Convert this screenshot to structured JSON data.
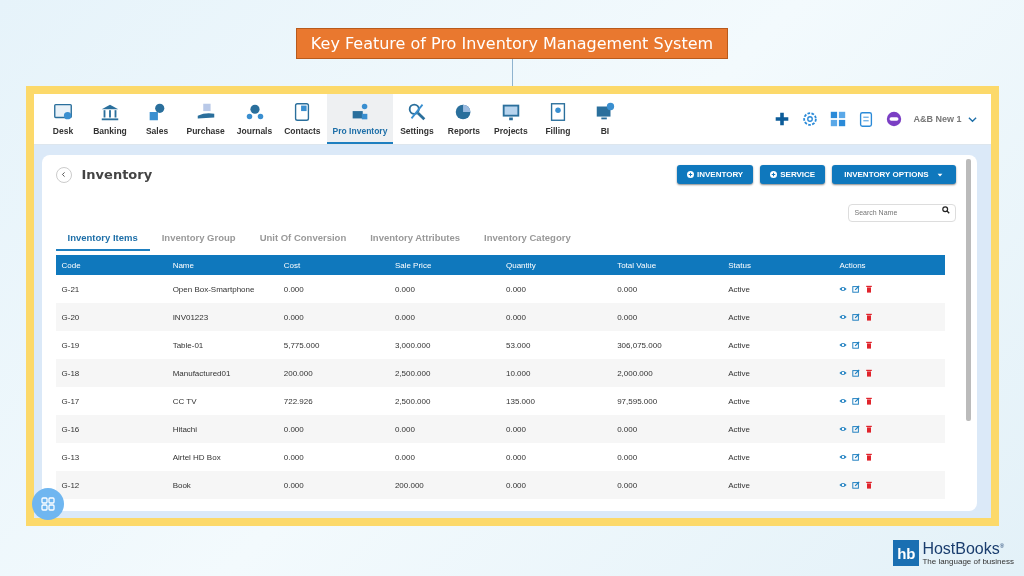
{
  "slide_title": "Key Feature of Pro Inventory Management System",
  "nav": [
    {
      "label": "Desk",
      "selected": false
    },
    {
      "label": "Banking",
      "selected": false
    },
    {
      "label": "Sales",
      "selected": false
    },
    {
      "label": "Purchase",
      "selected": false
    },
    {
      "label": "Journals",
      "selected": false
    },
    {
      "label": "Contacts",
      "selected": false
    },
    {
      "label": "Pro Inventory",
      "selected": true
    },
    {
      "label": "Settings",
      "selected": false
    },
    {
      "label": "Reports",
      "selected": false
    },
    {
      "label": "Projects",
      "selected": false
    },
    {
      "label": "Filling",
      "selected": false
    },
    {
      "label": "BI",
      "selected": false
    }
  ],
  "company": "A&B New 1",
  "page_title": "Inventory",
  "buttons": [
    {
      "label": "INVENTORY",
      "kind": "add"
    },
    {
      "label": "SERVICE",
      "kind": "add"
    },
    {
      "label": "INVENTORY OPTIONS",
      "kind": "dropdown"
    }
  ],
  "search": {
    "placeholder": "Search Name"
  },
  "tabs": [
    {
      "label": "Inventory Items",
      "selected": true
    },
    {
      "label": "Inventory Group",
      "selected": false
    },
    {
      "label": "Unit Of Conversion",
      "selected": false
    },
    {
      "label": "Inventory Attributes",
      "selected": false
    },
    {
      "label": "Inventory Category",
      "selected": false
    }
  ],
  "table": {
    "columns": [
      "Code",
      "Name",
      "Cost",
      "Sale Price",
      "Quantity",
      "Total Value",
      "Status",
      "Actions"
    ],
    "rows": [
      [
        "G-21",
        "Open Box-Smartphone",
        "0.000",
        "0.000",
        "0.000",
        "0.000",
        "Active"
      ],
      [
        "G-20",
        "INV01223",
        "0.000",
        "0.000",
        "0.000",
        "0.000",
        "Active"
      ],
      [
        "G-19",
        "Table-01",
        "5,775.000",
        "3,000.000",
        "53.000",
        "306,075.000",
        "Active"
      ],
      [
        "G-18",
        "Manufactured01",
        "200.000",
        "2,500.000",
        "10.000",
        "2,000.000",
        "Active"
      ],
      [
        "G-17",
        "CC TV",
        "722.926",
        "2,500.000",
        "135.000",
        "97,595.000",
        "Active"
      ],
      [
        "G-16",
        "Hitachi",
        "0.000",
        "0.000",
        "0.000",
        "0.000",
        "Active"
      ],
      [
        "G-13",
        "Airtel HD Box",
        "0.000",
        "0.000",
        "0.000",
        "0.000",
        "Active"
      ],
      [
        "G-12",
        "Book",
        "0.000",
        "200.000",
        "0.000",
        "0.000",
        "Active"
      ]
    ]
  },
  "brand": {
    "name": "HostBooks",
    "mark": "hb",
    "registered": "®",
    "tagline": "The language of business"
  }
}
